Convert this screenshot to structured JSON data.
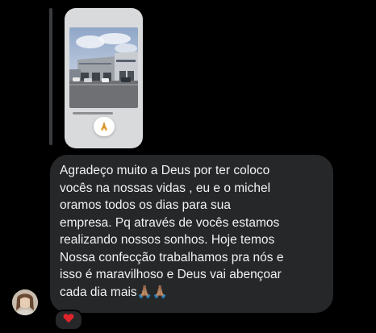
{
  "conversation": {
    "shared_story": {
      "thumbnail_icon": "building-photo",
      "sticker_icon": "praying-hands-icon"
    },
    "message": {
      "text": "Agradeço muito a Deus por ter coloco\nvocês na nossas vidas , eu e o michel\noramos todos os dias para sua\nempresa. Pq através de vocês estamos\nrealizando nossos sonhos. Hoje temos\nNossa confecção trabalhamos pra nós e\nisso é maravilhoso e Deus vai abençoar\ncada dia mais🙏🏽🙏🏽"
    },
    "sender": {
      "avatar_icon": "avatar-photo"
    },
    "reaction": {
      "emoji_icon": "red-heart-icon",
      "color": "#e0242c"
    }
  },
  "colors": {
    "background": "#000000",
    "bubble": "#262729",
    "text": "#f2f2f2",
    "reply_bar": "#3a3b3e"
  }
}
